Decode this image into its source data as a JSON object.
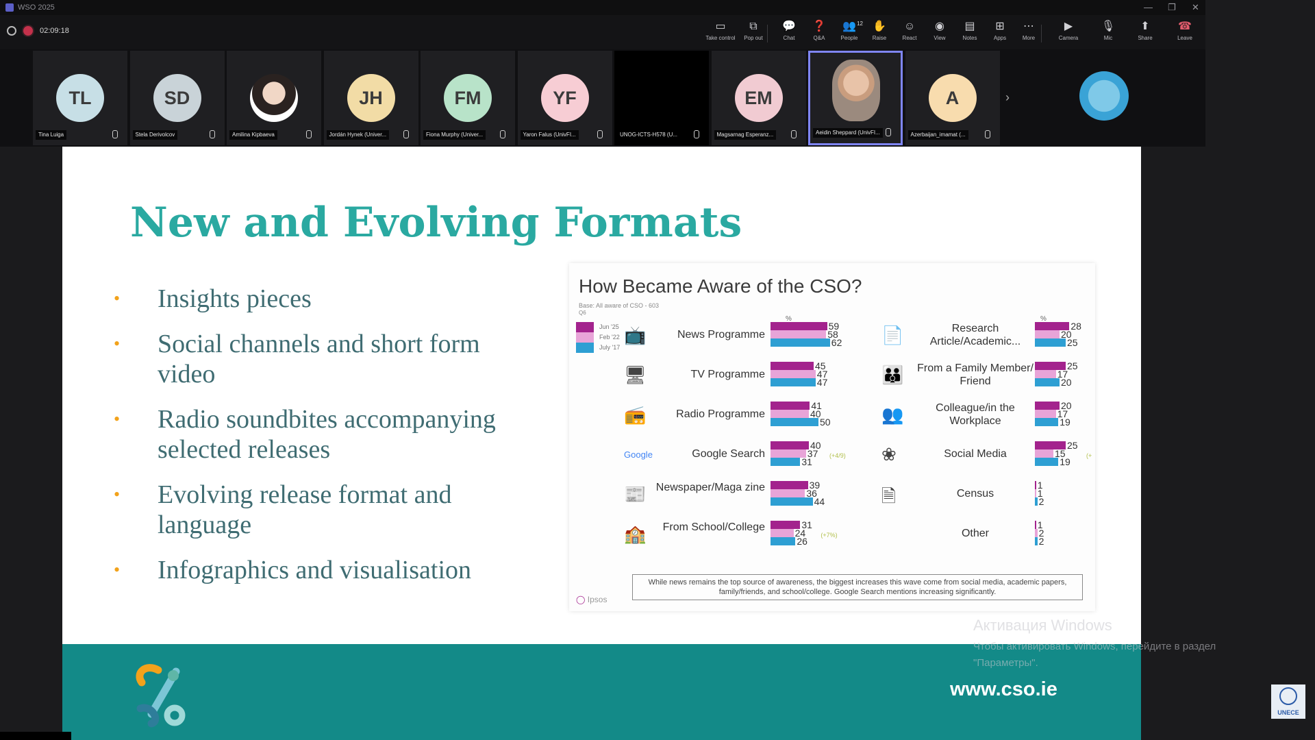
{
  "window": {
    "title": "WSO 2025"
  },
  "toolbar": {
    "timer": "02:09:18",
    "buttons": [
      {
        "label": "Take control",
        "icon": "screen-icon"
      },
      {
        "label": "Pop out",
        "icon": "popout-icon"
      },
      {
        "label": "Chat",
        "icon": "chat-icon"
      },
      {
        "label": "Q&A",
        "icon": "qa-icon"
      },
      {
        "label": "People",
        "icon": "people-icon",
        "badge": "12"
      },
      {
        "label": "Raise",
        "icon": "hand-icon"
      },
      {
        "label": "React",
        "icon": "smile-icon"
      },
      {
        "label": "View",
        "icon": "view-icon"
      },
      {
        "label": "Notes",
        "icon": "notes-icon"
      },
      {
        "label": "Apps",
        "icon": "apps-icon"
      },
      {
        "label": "More",
        "icon": "more-icon"
      },
      {
        "label": "Camera",
        "icon": "camera-icon"
      },
      {
        "label": "Mic",
        "icon": "mic-icon"
      },
      {
        "label": "Share",
        "icon": "share-icon"
      },
      {
        "label": "Leave",
        "icon": "phone-icon"
      }
    ]
  },
  "participants": [
    {
      "initials": "TL",
      "name": "Tina Luiga",
      "color": "#c7dfe6"
    },
    {
      "initials": "SD",
      "name": "Stela Derivolcov",
      "color": "#c9d3d8"
    },
    {
      "initials": "",
      "name": "Amilina Kipbaeva",
      "color": "#ffffff"
    },
    {
      "initials": "JH",
      "name": "Jordán Hynek (Univer...",
      "color": "#f2dca6"
    },
    {
      "initials": "FM",
      "name": "Fiona Murphy (Univer...",
      "color": "#b8e3c9"
    },
    {
      "initials": "YF",
      "name": "Yaron Falus (UnivFI...",
      "color": "#f7cdd4"
    },
    {
      "initials": "",
      "name": "UNOG-ICTS-H578 (U...",
      "color": "#000000"
    },
    {
      "initials": "EM",
      "name": "Magsarnag Esperanz...",
      "color": "#f1cbd2"
    },
    {
      "initials": "",
      "name": "Aeidin Sheppard (UnivFI...",
      "color": "#a9958a"
    },
    {
      "initials": "A",
      "name": "Azerbaijan_imamat (...",
      "color": "#f8dcae"
    }
  ],
  "slide": {
    "title": "New and Evolving Formats",
    "bullets": [
      "Insights pieces",
      "Social channels and short form video",
      "Radio soundbites accompanying selected releases",
      "Evolving release format and language",
      "Infographics and visualisation"
    ],
    "footer_url": "www.cso.ie"
  },
  "chart_data": {
    "type": "bar",
    "title": "How Became Aware of the CSO?",
    "base": "Base: All aware of CSO - 603",
    "question": "Q6",
    "unit": "%",
    "series": [
      {
        "name": "Jun '25",
        "color": "#a3238d"
      },
      {
        "name": "Feb '22",
        "color": "#e8a4d8"
      },
      {
        "name": "July '17",
        "color": "#2e9fd3"
      }
    ],
    "left_panel": [
      {
        "category": "News Programme",
        "values": [
          59,
          58,
          62
        ],
        "icon": "tv-news-icon"
      },
      {
        "category": "TV Programme",
        "values": [
          45,
          47,
          47
        ],
        "icon": "monitor-icon"
      },
      {
        "category": "Radio Programme",
        "values": [
          41,
          40,
          50
        ],
        "icon": "radio-icon"
      },
      {
        "category": "Google Search",
        "values": [
          40,
          37,
          31
        ],
        "icon": "google-icon",
        "change": "(+4/9)"
      },
      {
        "category": "Newspaper/Maga zine",
        "values": [
          39,
          36,
          44
        ],
        "icon": "newspaper-icon"
      },
      {
        "category": "From School/College",
        "values": [
          31,
          24,
          26
        ],
        "icon": "school-icon",
        "change": "(+7%)"
      }
    ],
    "right_panel": [
      {
        "category": "Research Article/Academic...",
        "values": [
          28,
          20,
          25
        ],
        "icon": "document-icon"
      },
      {
        "category": "From a Family Member/ Friend",
        "values": [
          25,
          17,
          20
        ],
        "icon": "family-icon"
      },
      {
        "category": "Colleague/in the Workplace",
        "values": [
          20,
          17,
          19
        ],
        "icon": "colleagues-icon"
      },
      {
        "category": "Social Media",
        "values": [
          25,
          15,
          19
        ],
        "icon": "social-media-icon",
        "change": "(+"
      },
      {
        "category": "Census",
        "values": [
          1,
          1,
          2
        ],
        "icon": "census-doc-icon"
      },
      {
        "category": "Other",
        "values": [
          1,
          2,
          2
        ],
        "icon": ""
      }
    ],
    "google_word": "Google",
    "note": "While news remains the top source of awareness, the biggest increases this wave come from social media, academic papers, family/friends, and school/college. Google Search mentions increasing significantly.",
    "source_logo": "Ipsos"
  },
  "watermark": {
    "line1": "Активация Windows",
    "line2": "Чтобы активировать Windows, перейдите в раздел",
    "line3": "\"Параметры\"."
  },
  "corner_logo": "UNECE"
}
